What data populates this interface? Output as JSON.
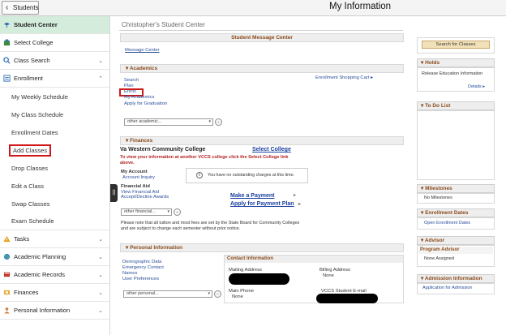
{
  "header": {
    "back_label": "Students",
    "title": "My Information"
  },
  "sidebar": {
    "student_center": "Student Center",
    "select_college": "Select College",
    "class_search": "Class Search",
    "enrollment": "Enrollment",
    "enrollment_items": [
      "My Weekly Schedule",
      "My Class Schedule",
      "Enrollment Dates",
      "Add Classes",
      "Drop Classes",
      "Edit a Class",
      "Swap Classes",
      "Exam Schedule"
    ],
    "tasks": "Tasks",
    "academic_planning": "Academic Planning",
    "academic_records": "Academic Records",
    "finances": "Finances",
    "personal_information": "Personal Information"
  },
  "main": {
    "heading": "Christopher's Student Center",
    "message_center": {
      "title": "Student Message Center",
      "link": "Message Center"
    },
    "academics": {
      "title": "Academics",
      "links": [
        "Search",
        "Plan",
        "Enroll",
        "My Academics",
        "Apply for Graduation"
      ],
      "cart": "Enrollment Shopping Cart",
      "select": "other academic..."
    },
    "finances": {
      "title": "Finances",
      "college": "Va Western Community College",
      "select_college": "Select College",
      "notice": "To view your information at another VCCS college click the Select College link above.",
      "my_account": "My Account",
      "account_inquiry": "Account Inquiry",
      "no_charges": "You have no outstanding charges at this time.",
      "financial_aid": "Financial Aid",
      "view_aid": "View Financial Aid",
      "accept_aid": "Accept/Decline Awards",
      "make_payment": "Make a Payment",
      "payment_plan": "Apply for Payment Plan",
      "select": "other financial...",
      "tuition_note": "Please note that all tuition and most fees are set by the State Board for Community Colleges and are subject to change each semester without prior notice."
    },
    "personal": {
      "title": "Personal Information",
      "links": [
        "Demographic Data",
        "Emergency Contact",
        "Names",
        "User Preferences"
      ],
      "select": "other personal...",
      "contact_title": "Contact Information",
      "mailing_address": "Mailing Address",
      "billing_address": "Billing Address",
      "billing_value": "None",
      "main_phone": "Main Phone",
      "phone_value": "None",
      "email_label": "VCCS Student E-mail"
    }
  },
  "right": {
    "search_classes": "Search for Classes",
    "holds": {
      "title": "Holds",
      "item": "Release Education Information",
      "details": "Details"
    },
    "todo": {
      "title": "To Do List"
    },
    "milestones": {
      "title": "Milestones",
      "value": "No Milestones"
    },
    "enrollment_dates": {
      "title": "Enrollment Dates",
      "link": "Open Enrollment Dates"
    },
    "advisor": {
      "title": "Advisor",
      "sub": "Program Advisor",
      "value": "None Assigned"
    },
    "admission": {
      "title": "Admission Information",
      "link": "Application for Admission"
    }
  },
  "colors": {
    "active_nav": "#d3ecdc",
    "highlight_red": "#cc1a1a",
    "link_blue": "#2a4f9a",
    "header_brown": "#8a4a1a"
  }
}
